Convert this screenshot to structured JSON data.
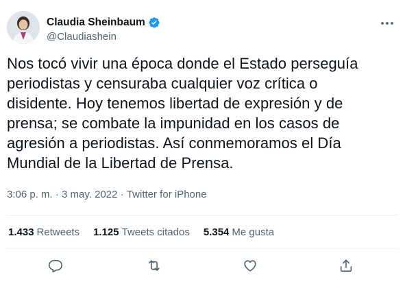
{
  "author": {
    "name": "Claudia Sheinbaum",
    "handle": "@Claudiashein"
  },
  "tweet": {
    "text": "Nos tocó vivir una época donde el Estado perseguía\nperiodistas y censuraba cualquier voz crítica o\ndisidente. Hoy tenemos libertad de expresión y de\nprensa; se combate la impunidad en los casos de\nagresión a periodistas. Así conmemoramos el Día\nMundial de la Libertad de Prensa.",
    "time": "3:06 p. m.",
    "separator": " · ",
    "date": "3 may. 2022",
    "source": "Twitter for iPhone"
  },
  "stats": {
    "retweets_count": "1.433",
    "retweets_label": "Retweets",
    "quotes_count": "1.125",
    "quotes_label": "Tweets citados",
    "likes_count": "5.354",
    "likes_label": "Me gusta"
  },
  "icons": {
    "verified": "verified-badge-icon",
    "more": "more-options-icon",
    "reply": "reply-icon",
    "retweet": "retweet-icon",
    "like": "heart-icon",
    "share": "share-icon"
  },
  "colors": {
    "text": "#0f1419",
    "secondary": "#536471",
    "verified": "#1d9bf0",
    "divider": "#eff3f4"
  }
}
